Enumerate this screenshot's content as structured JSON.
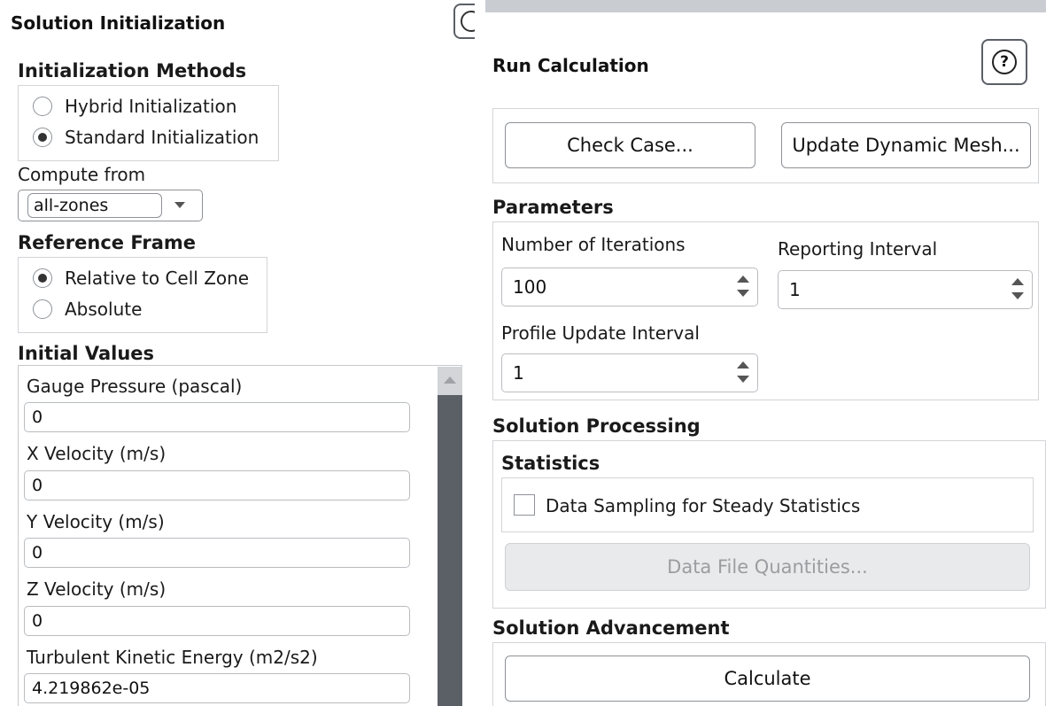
{
  "init": {
    "title": "Solution Initialization",
    "methods_heading": "Initialization Methods",
    "methods": [
      {
        "label": "Hybrid  Initialization",
        "selected": false
      },
      {
        "label": "Standard Initialization",
        "selected": true
      }
    ],
    "compute_from_label": "Compute from",
    "compute_from_value": "all-zones",
    "reference_frame_heading": "Reference Frame",
    "reference_frames": [
      {
        "label": "Relative to Cell Zone",
        "selected": true
      },
      {
        "label": "Absolute",
        "selected": false
      }
    ],
    "initial_values_heading": "Initial Values",
    "fields": [
      {
        "label": "Gauge Pressure (pascal)",
        "value": "0"
      },
      {
        "label": "X Velocity (m/s)",
        "value": "0"
      },
      {
        "label": "Y Velocity (m/s)",
        "value": "0"
      },
      {
        "label": "Z Velocity (m/s)",
        "value": "0"
      },
      {
        "label": "Turbulent Kinetic Energy (m2/s2)",
        "value": "4.219862e-05"
      }
    ]
  },
  "run": {
    "title": "Run Calculation",
    "help_icon": "question-icon",
    "check_case_label": "Check Case...",
    "update_mesh_label": "Update Dynamic Mesh...",
    "parameters_heading": "Parameters",
    "num_iterations_label": "Number of Iterations",
    "num_iterations_value": "100",
    "reporting_interval_label": "Reporting Interval",
    "reporting_interval_value": "1",
    "profile_update_label": "Profile Update Interval",
    "profile_update_value": "1",
    "solution_processing_heading": "Solution Processing",
    "statistics_heading": "Statistics",
    "data_sampling_label": "Data Sampling for Steady Statistics",
    "data_sampling_checked": false,
    "data_file_quantities_label": "Data File Quantities...",
    "solution_advancement_heading": "Solution Advancement",
    "calculate_label": "Calculate"
  }
}
